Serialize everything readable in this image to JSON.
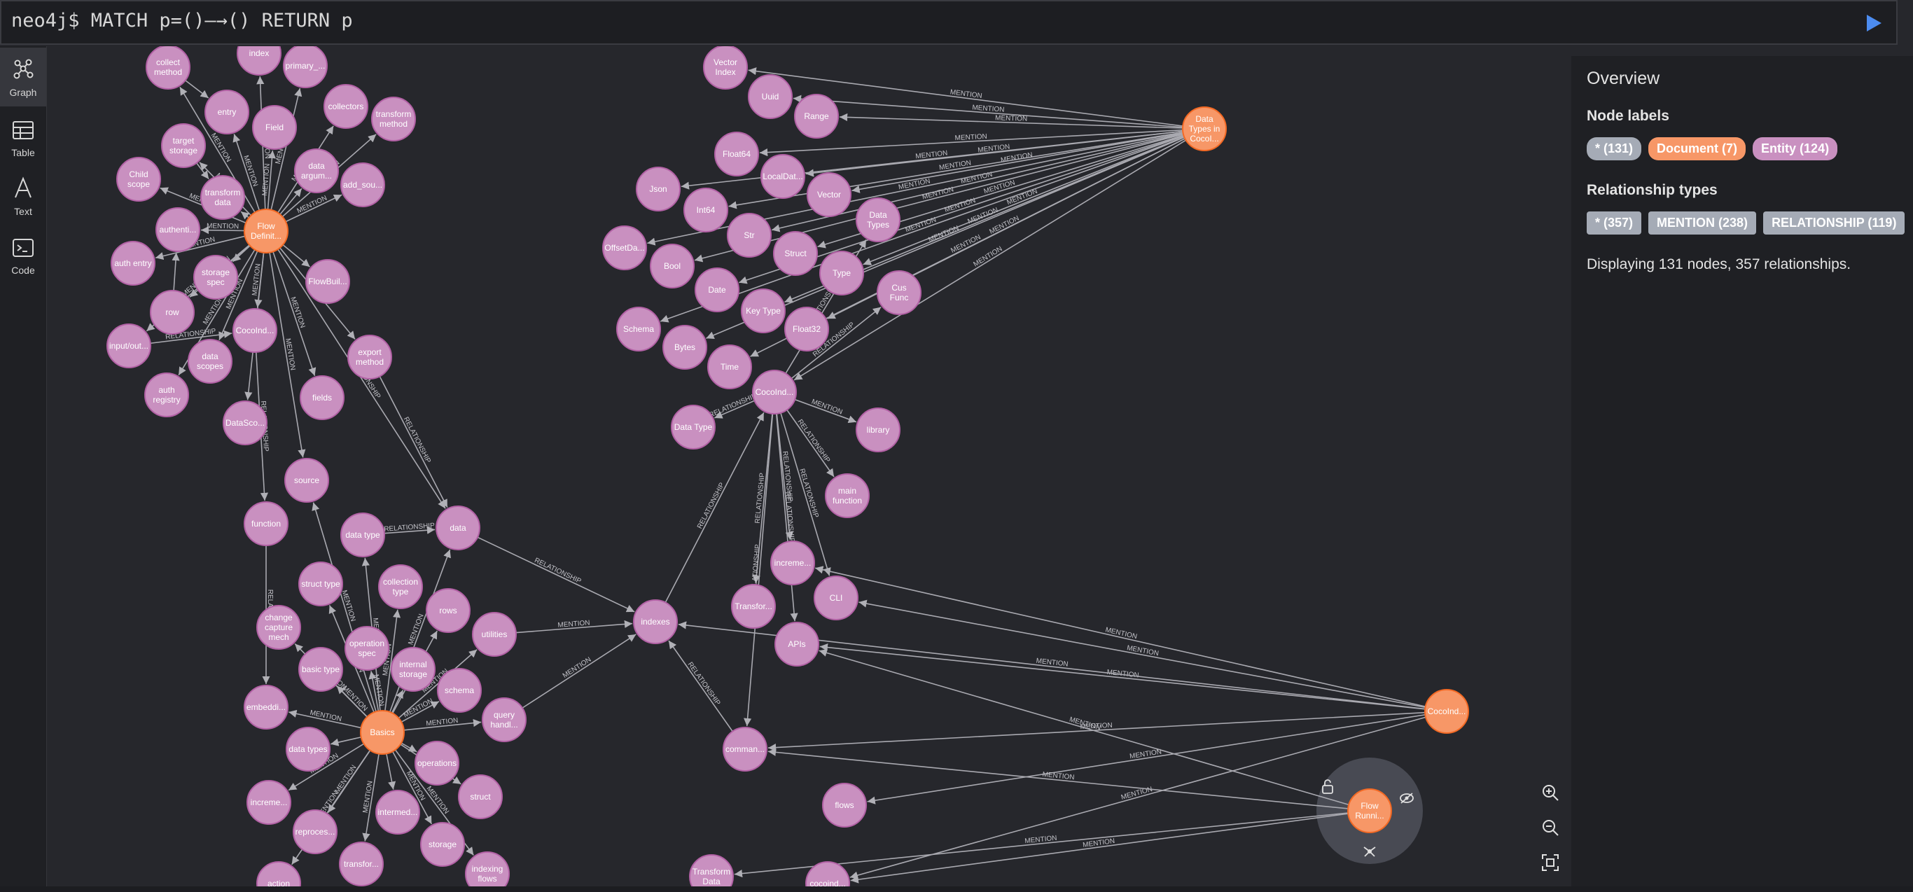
{
  "query": {
    "prompt": "neo4j$ ",
    "text": "MATCH p=()—→() RETURN p",
    "run_icon": "play-icon",
    "run_color": "#4c8cf0"
  },
  "sidebar": {
    "items": [
      {
        "label": "Graph",
        "icon": "graph-icon",
        "active": true
      },
      {
        "label": "Table",
        "icon": "table-icon",
        "active": false
      },
      {
        "label": "Text",
        "icon": "text-icon",
        "active": false
      },
      {
        "label": "Code",
        "icon": "code-icon",
        "active": false
      }
    ]
  },
  "overview": {
    "title": "Overview",
    "node_labels_heading": "Node labels",
    "node_labels": [
      {
        "text": "* (131)",
        "color": "#a5abb6"
      },
      {
        "text": "Document (7)",
        "color": "#f79767"
      },
      {
        "text": "Entity (124)",
        "color": "#c990c0"
      }
    ],
    "rel_types_heading": "Relationship types",
    "rel_types": [
      {
        "text": "* (357)",
        "color": "#a5abb6"
      },
      {
        "text": "MENTION (238)",
        "color": "#a5abb6"
      },
      {
        "text": "RELATIONSHIP (119)",
        "color": "#a5abb6"
      }
    ],
    "summary": "Displaying 131 nodes, 357 relationships."
  },
  "colors": {
    "document": "#f79767",
    "entity": "#c990c0",
    "edge": "#a9a9b0",
    "background": "#26272c"
  },
  "graph": {
    "nodes": [
      {
        "id": "flowdef",
        "label": "Flow\nDefinit...",
        "type": "document"
      },
      {
        "id": "basics",
        "label": "Basics",
        "type": "document"
      },
      {
        "id": "datatypes",
        "label": "Data\nTypes in\nCocoI...",
        "type": "document"
      },
      {
        "id": "cocoind2",
        "label": "CocoInd...",
        "type": "document"
      },
      {
        "id": "flowrun",
        "label": "Flow\nRunni...",
        "type": "document"
      },
      {
        "id": "collect",
        "label": "collect\nmethod",
        "type": "entity"
      },
      {
        "id": "index",
        "label": "index",
        "type": "entity"
      },
      {
        "id": "primary",
        "label": "primary_...",
        "type": "entity"
      },
      {
        "id": "entry",
        "label": "entry",
        "type": "entity"
      },
      {
        "id": "field",
        "label": "Field",
        "type": "entity"
      },
      {
        "id": "collectors",
        "label": "collectors",
        "type": "entity"
      },
      {
        "id": "transform",
        "label": "transform\nmethod",
        "type": "entity"
      },
      {
        "id": "target",
        "label": "target\nstorage",
        "type": "entity"
      },
      {
        "id": "dataarg",
        "label": "data\nargum...",
        "type": "entity"
      },
      {
        "id": "addsou",
        "label": "add_sou...",
        "type": "entity"
      },
      {
        "id": "childscope",
        "label": "Child\nscope",
        "type": "entity"
      },
      {
        "id": "transdata",
        "label": "transform\ndata",
        "type": "entity"
      },
      {
        "id": "authenti",
        "label": "authenti...",
        "type": "entity"
      },
      {
        "id": "authentry",
        "label": "auth entry",
        "type": "entity"
      },
      {
        "id": "storagespec",
        "label": "storage\nspec",
        "type": "entity"
      },
      {
        "id": "flowbuil",
        "label": "FlowBuil...",
        "type": "entity"
      },
      {
        "id": "row",
        "label": "row",
        "type": "entity"
      },
      {
        "id": "cocoind1",
        "label": "CocoInd...",
        "type": "entity"
      },
      {
        "id": "inputout",
        "label": "input/out...",
        "type": "entity"
      },
      {
        "id": "datascopes",
        "label": "data\nscopes",
        "type": "entity"
      },
      {
        "id": "authreg",
        "label": "auth\nregistry",
        "type": "entity"
      },
      {
        "id": "export",
        "label": "export\nmethod",
        "type": "entity"
      },
      {
        "id": "fields",
        "label": "fields",
        "type": "entity"
      },
      {
        "id": "datasco",
        "label": "DataSco...",
        "type": "entity"
      },
      {
        "id": "source",
        "label": "source",
        "type": "entity"
      },
      {
        "id": "function",
        "label": "function",
        "type": "entity"
      },
      {
        "id": "datatype",
        "label": "data type",
        "type": "entity"
      },
      {
        "id": "data",
        "label": "data",
        "type": "entity"
      },
      {
        "id": "colltype",
        "label": "collection\ntype",
        "type": "entity"
      },
      {
        "id": "structtype",
        "label": "struct type",
        "type": "entity"
      },
      {
        "id": "rows",
        "label": "rows",
        "type": "entity"
      },
      {
        "id": "changecap",
        "label": "change\ncapture\nmech",
        "type": "entity"
      },
      {
        "id": "opspec",
        "label": "operation\nspec",
        "type": "entity"
      },
      {
        "id": "utilities",
        "label": "utilities",
        "type": "entity"
      },
      {
        "id": "basictype",
        "label": "basic type",
        "type": "entity"
      },
      {
        "id": "internal",
        "label": "internal\nstorage",
        "type": "entity"
      },
      {
        "id": "schema",
        "label": "schema",
        "type": "entity"
      },
      {
        "id": "embeddi",
        "label": "embeddi...",
        "type": "entity"
      },
      {
        "id": "queryhand",
        "label": "query\nhandl...",
        "type": "entity"
      },
      {
        "id": "datatypes2",
        "label": "data types",
        "type": "entity"
      },
      {
        "id": "operations",
        "label": "operations",
        "type": "entity"
      },
      {
        "id": "struct",
        "label": "struct",
        "type": "entity"
      },
      {
        "id": "increme1",
        "label": "increme...",
        "type": "entity"
      },
      {
        "id": "intermed",
        "label": "intermed...",
        "type": "entity"
      },
      {
        "id": "reproces",
        "label": "reproces...",
        "type": "entity"
      },
      {
        "id": "storage",
        "label": "storage",
        "type": "entity"
      },
      {
        "id": "transfor1",
        "label": "transfor...",
        "type": "entity"
      },
      {
        "id": "indexing",
        "label": "indexing\nflows",
        "type": "entity"
      },
      {
        "id": "action",
        "label": "action",
        "type": "entity"
      },
      {
        "id": "indexes",
        "label": "indexes",
        "type": "entity"
      },
      {
        "id": "vectorindex",
        "label": "Vector\nIndex",
        "type": "entity"
      },
      {
        "id": "uuid",
        "label": "Uuid",
        "type": "entity"
      },
      {
        "id": "range",
        "label": "Range",
        "type": "entity"
      },
      {
        "id": "float64",
        "label": "Float64",
        "type": "entity"
      },
      {
        "id": "localdat",
        "label": "LocalDat...",
        "type": "entity"
      },
      {
        "id": "json",
        "label": "Json",
        "type": "entity"
      },
      {
        "id": "vector",
        "label": "Vector",
        "type": "entity"
      },
      {
        "id": "int64",
        "label": "Int64",
        "type": "entity"
      },
      {
        "id": "datatypesR",
        "label": "Data\nTypes",
        "type": "entity"
      },
      {
        "id": "str",
        "label": "Str",
        "type": "entity"
      },
      {
        "id": "offsetda",
        "label": "OffsetDa...",
        "type": "entity"
      },
      {
        "id": "structR",
        "label": "Struct",
        "type": "entity"
      },
      {
        "id": "bool",
        "label": "Bool",
        "type": "entity"
      },
      {
        "id": "type",
        "label": "Type",
        "type": "entity"
      },
      {
        "id": "date",
        "label": "Date",
        "type": "entity"
      },
      {
        "id": "cusfunc",
        "label": "Cus\nFunc",
        "type": "entity"
      },
      {
        "id": "keytype",
        "label": "Key Type",
        "type": "entity"
      },
      {
        "id": "schemaR",
        "label": "Schema",
        "type": "entity"
      },
      {
        "id": "float32",
        "label": "Float32",
        "type": "entity"
      },
      {
        "id": "bytes",
        "label": "Bytes",
        "type": "entity"
      },
      {
        "id": "time",
        "label": "Time",
        "type": "entity"
      },
      {
        "id": "cocoind3",
        "label": "CocoInd...",
        "type": "entity"
      },
      {
        "id": "library",
        "label": "library",
        "type": "entity"
      },
      {
        "id": "datatypeR",
        "label": "Data Type",
        "type": "entity"
      },
      {
        "id": "mainfunc",
        "label": "main\nfunction",
        "type": "entity"
      },
      {
        "id": "increme2",
        "label": "increme...",
        "type": "entity"
      },
      {
        "id": "transfor2",
        "label": "Transfor...",
        "type": "entity"
      },
      {
        "id": "cli",
        "label": "CLI",
        "type": "entity"
      },
      {
        "id": "apis",
        "label": "APIs",
        "type": "entity"
      },
      {
        "id": "comman",
        "label": "comman...",
        "type": "entity"
      },
      {
        "id": "flows",
        "label": "flows",
        "type": "entity"
      },
      {
        "id": "transdata2",
        "label": "Transform\nData",
        "type": "entity"
      },
      {
        "id": "cocoind4",
        "label": "cocoind...",
        "type": "entity"
      }
    ],
    "edges": [
      {
        "s": "flowdef",
        "t": "collect",
        "l": "MENTION"
      },
      {
        "s": "flowdef",
        "t": "index",
        "l": "MENTION"
      },
      {
        "s": "flowdef",
        "t": "primary",
        "l": "MENTION"
      },
      {
        "s": "flowdef",
        "t": "entry",
        "l": "MENTION"
      },
      {
        "s": "flowdef",
        "t": "field",
        "l": "MENTION"
      },
      {
        "s": "flowdef",
        "t": "collectors",
        "l": "MENTION"
      },
      {
        "s": "flowdef",
        "t": "transform",
        "l": "MENTION"
      },
      {
        "s": "flowdef",
        "t": "target",
        "l": "MENTION"
      },
      {
        "s": "flowdef",
        "t": "dataarg",
        "l": "MENTION"
      },
      {
        "s": "flowdef",
        "t": "addsou",
        "l": "MENTION"
      },
      {
        "s": "flowdef",
        "t": "childscope",
        "l": "MENTION"
      },
      {
        "s": "flowdef",
        "t": "transdata",
        "l": "MENTION"
      },
      {
        "s": "flowdef",
        "t": "authenti",
        "l": "MENTION"
      },
      {
        "s": "flowdef",
        "t": "authentry",
        "l": "MENTION"
      },
      {
        "s": "flowdef",
        "t": "storagespec",
        "l": "MENTION"
      },
      {
        "s": "flowdef",
        "t": "flowbuil",
        "l": "MENTION"
      },
      {
        "s": "flowdef",
        "t": "row",
        "l": "MENTION"
      },
      {
        "s": "flowdef",
        "t": "cocoind1",
        "l": "MENTION"
      },
      {
        "s": "flowdef",
        "t": "inputout",
        "l": "MENTION"
      },
      {
        "s": "flowdef",
        "t": "datascopes",
        "l": "MENTION"
      },
      {
        "s": "flowdef",
        "t": "authreg",
        "l": "MENTION"
      },
      {
        "s": "flowdef",
        "t": "export",
        "l": "MENTION"
      },
      {
        "s": "flowdef",
        "t": "fields",
        "l": "MENTION"
      },
      {
        "s": "flowdef",
        "t": "datasco",
        "l": "MENTION"
      },
      {
        "s": "flowdef",
        "t": "source",
        "l": "MENTION"
      },
      {
        "s": "flowdef",
        "t": "data",
        "l": "RELATIONSHIP"
      },
      {
        "s": "collect",
        "t": "entry",
        "l": "RELATIONSHIP"
      },
      {
        "s": "target",
        "t": "transdata",
        "l": "RELATIONSHIP"
      },
      {
        "s": "row",
        "t": "authenti",
        "l": "RELATIONSHIP"
      },
      {
        "s": "inputout",
        "t": "cocoind1",
        "l": "RELATIONSHIP"
      },
      {
        "s": "cocoind1",
        "t": "function",
        "l": "RELATIONSHIP"
      },
      {
        "s": "export",
        "t": "data",
        "l": "RELATIONSHIP"
      },
      {
        "s": "function",
        "t": "embeddi",
        "l": "RELATIONSHIP"
      },
      {
        "s": "basics",
        "t": "datatype",
        "l": "MENTION"
      },
      {
        "s": "basics",
        "t": "data",
        "l": "MENTION"
      },
      {
        "s": "basics",
        "t": "colltype",
        "l": "MENTION"
      },
      {
        "s": "basics",
        "t": "structtype",
        "l": "MENTION"
      },
      {
        "s": "basics",
        "t": "rows",
        "l": "MENTION"
      },
      {
        "s": "basics",
        "t": "changecap",
        "l": "MENTION"
      },
      {
        "s": "basics",
        "t": "opspec",
        "l": "MENTION"
      },
      {
        "s": "basics",
        "t": "utilities",
        "l": "MENTION"
      },
      {
        "s": "basics",
        "t": "basictype",
        "l": "MENTION"
      },
      {
        "s": "basics",
        "t": "internal",
        "l": "MENTION"
      },
      {
        "s": "basics",
        "t": "schema",
        "l": "MENTION"
      },
      {
        "s": "basics",
        "t": "embeddi",
        "l": "MENTION"
      },
      {
        "s": "basics",
        "t": "queryhand",
        "l": "MENTION"
      },
      {
        "s": "basics",
        "t": "datatypes2",
        "l": "MENTION"
      },
      {
        "s": "basics",
        "t": "operations",
        "l": "MENTION"
      },
      {
        "s": "basics",
        "t": "struct",
        "l": "MENTION"
      },
      {
        "s": "basics",
        "t": "increme1",
        "l": "MENTION"
      },
      {
        "s": "basics",
        "t": "intermed",
        "l": "MENTION"
      },
      {
        "s": "basics",
        "t": "reproces",
        "l": "MENTION"
      },
      {
        "s": "basics",
        "t": "storage",
        "l": "MENTION"
      },
      {
        "s": "basics",
        "t": "transfor1",
        "l": "MENTION"
      },
      {
        "s": "basics",
        "t": "indexing",
        "l": "MENTION"
      },
      {
        "s": "basics",
        "t": "action",
        "l": "MENTION"
      },
      {
        "s": "basics",
        "t": "source",
        "l": "MENTION"
      },
      {
        "s": "datatype",
        "t": "data",
        "l": "RELATIONSHIP"
      },
      {
        "s": "utilities",
        "t": "indexes",
        "l": "MENTION"
      },
      {
        "s": "queryhand",
        "t": "indexes",
        "l": "MENTION"
      },
      {
        "s": "data",
        "t": "indexes",
        "l": "RELATIONSHIP"
      },
      {
        "s": "indexes",
        "t": "cocoind3",
        "l": "RELATIONSHIP"
      },
      {
        "s": "datatypes",
        "t": "vectorindex",
        "l": "MENTION"
      },
      {
        "s": "datatypes",
        "t": "uuid",
        "l": "MENTION"
      },
      {
        "s": "datatypes",
        "t": "range",
        "l": "MENTION"
      },
      {
        "s": "datatypes",
        "t": "float64",
        "l": "MENTION"
      },
      {
        "s": "datatypes",
        "t": "localdat",
        "l": "MENTION"
      },
      {
        "s": "datatypes",
        "t": "json",
        "l": "MENTION"
      },
      {
        "s": "datatypes",
        "t": "vector",
        "l": "MENTION"
      },
      {
        "s": "datatypes",
        "t": "int64",
        "l": "MENTION"
      },
      {
        "s": "datatypes",
        "t": "str",
        "l": "MENTION"
      },
      {
        "s": "datatypes",
        "t": "offsetda",
        "l": "MENTION"
      },
      {
        "s": "datatypes",
        "t": "structR",
        "l": "MENTION"
      },
      {
        "s": "datatypes",
        "t": "bool",
        "l": "MENTION"
      },
      {
        "s": "datatypes",
        "t": "type",
        "l": "MENTION"
      },
      {
        "s": "datatypes",
        "t": "date",
        "l": "MENTION"
      },
      {
        "s": "datatypes",
        "t": "keytype",
        "l": "MENTION"
      },
      {
        "s": "datatypes",
        "t": "schemaR",
        "l": "MENTION"
      },
      {
        "s": "datatypes",
        "t": "float32",
        "l": "MENTION"
      },
      {
        "s": "datatypes",
        "t": "bytes",
        "l": "MENTION"
      },
      {
        "s": "datatypes",
        "t": "time",
        "l": "MENTION"
      },
      {
        "s": "datatypes",
        "t": "cocoind3",
        "l": "MENTION"
      },
      {
        "s": "cocoind3",
        "t": "datatypeR",
        "l": "RELATIONSHIP"
      },
      {
        "s": "cocoind3",
        "t": "library",
        "l": "MENTION"
      },
      {
        "s": "cocoind3",
        "t": "mainfunc",
        "l": "RELATIONSHIP"
      },
      {
        "s": "cocoind3",
        "t": "increme2",
        "l": "RELATIONSHIP"
      },
      {
        "s": "cocoind3",
        "t": "transfor2",
        "l": "RELATIONSHIP"
      },
      {
        "s": "cocoind3",
        "t": "cli",
        "l": "RELATIONSHIP"
      },
      {
        "s": "cocoind3",
        "t": "apis",
        "l": "RELATIONSHIP"
      },
      {
        "s": "cocoind3",
        "t": "comman",
        "l": "RELATIONSHIP"
      },
      {
        "s": "cocoind3",
        "t": "datatypesR",
        "l": "RELATIONSHIP"
      },
      {
        "s": "cocoind3",
        "t": "cusfunc",
        "l": "RELATIONSHIP"
      },
      {
        "s": "cocoind2",
        "t": "cli",
        "l": "MENTION"
      },
      {
        "s": "cocoind2",
        "t": "apis",
        "l": "MENTION"
      },
      {
        "s": "cocoind2",
        "t": "increme2",
        "l": "MENTION"
      },
      {
        "s": "cocoind2",
        "t": "comman",
        "l": "MENTION"
      },
      {
        "s": "cocoind2",
        "t": "flows",
        "l": "MENTION"
      },
      {
        "s": "cocoind2",
        "t": "indexes",
        "l": "MENTION"
      },
      {
        "s": "cocoind2",
        "t": "cocoind4",
        "l": "MENTION"
      },
      {
        "s": "flowrun",
        "t": "comman",
        "l": "MENTION"
      },
      {
        "s": "flowrun",
        "t": "transdata2",
        "l": "MENTION"
      },
      {
        "s": "flowrun",
        "t": "cocoind4",
        "l": "MENTION"
      },
      {
        "s": "flowrun",
        "t": "apis",
        "l": "MENTION"
      },
      {
        "s": "comman",
        "t": "indexes",
        "l": "RELATIONSHIP"
      }
    ]
  }
}
